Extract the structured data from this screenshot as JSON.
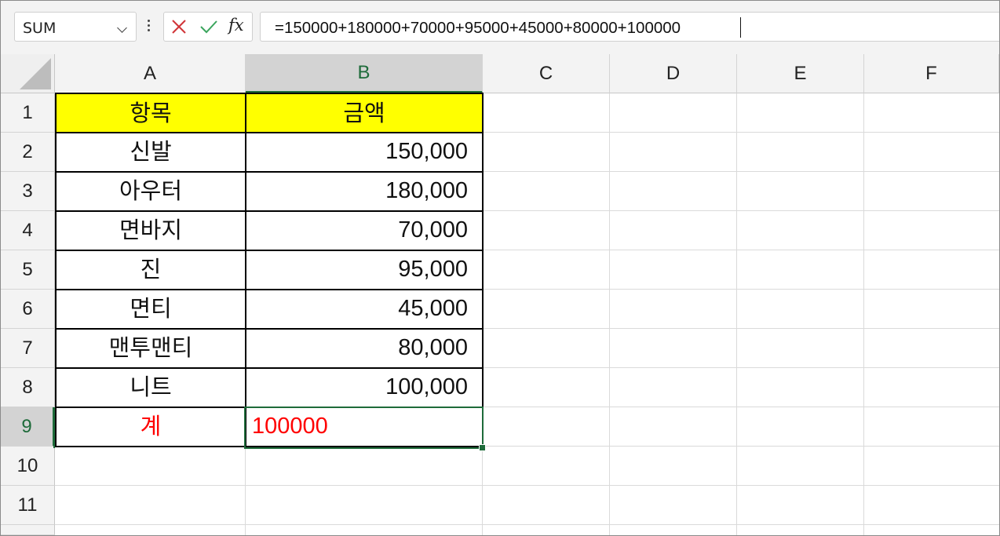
{
  "formula_bar": {
    "name_box": "SUM",
    "cancel_icon": "close-icon",
    "enter_icon": "checkmark-icon",
    "fx_label": "fx",
    "formula": "=150000+180000+70000+95000+45000+80000+100000"
  },
  "columns": [
    "A",
    "B",
    "C",
    "D",
    "E",
    "F"
  ],
  "rows": [
    "1",
    "2",
    "3",
    "4",
    "5",
    "6",
    "7",
    "8",
    "9",
    "10",
    "11"
  ],
  "selected": {
    "column": "B",
    "row": "9"
  },
  "header_fill_color": "#ffff00",
  "accent_color": "#1e6b3a",
  "sheet": {
    "header": {
      "a": "항목",
      "b": "금액"
    },
    "data": [
      {
        "a": "신발",
        "b": "150,000"
      },
      {
        "a": "아우터",
        "b": "180,000"
      },
      {
        "a": "면바지",
        "b": "70,000"
      },
      {
        "a": "진",
        "b": "95,000"
      },
      {
        "a": "면티",
        "b": "45,000"
      },
      {
        "a": "맨투맨티",
        "b": "80,000"
      },
      {
        "a": "니트",
        "b": "100,000"
      }
    ],
    "total": {
      "a": "계",
      "b": "100000"
    }
  }
}
